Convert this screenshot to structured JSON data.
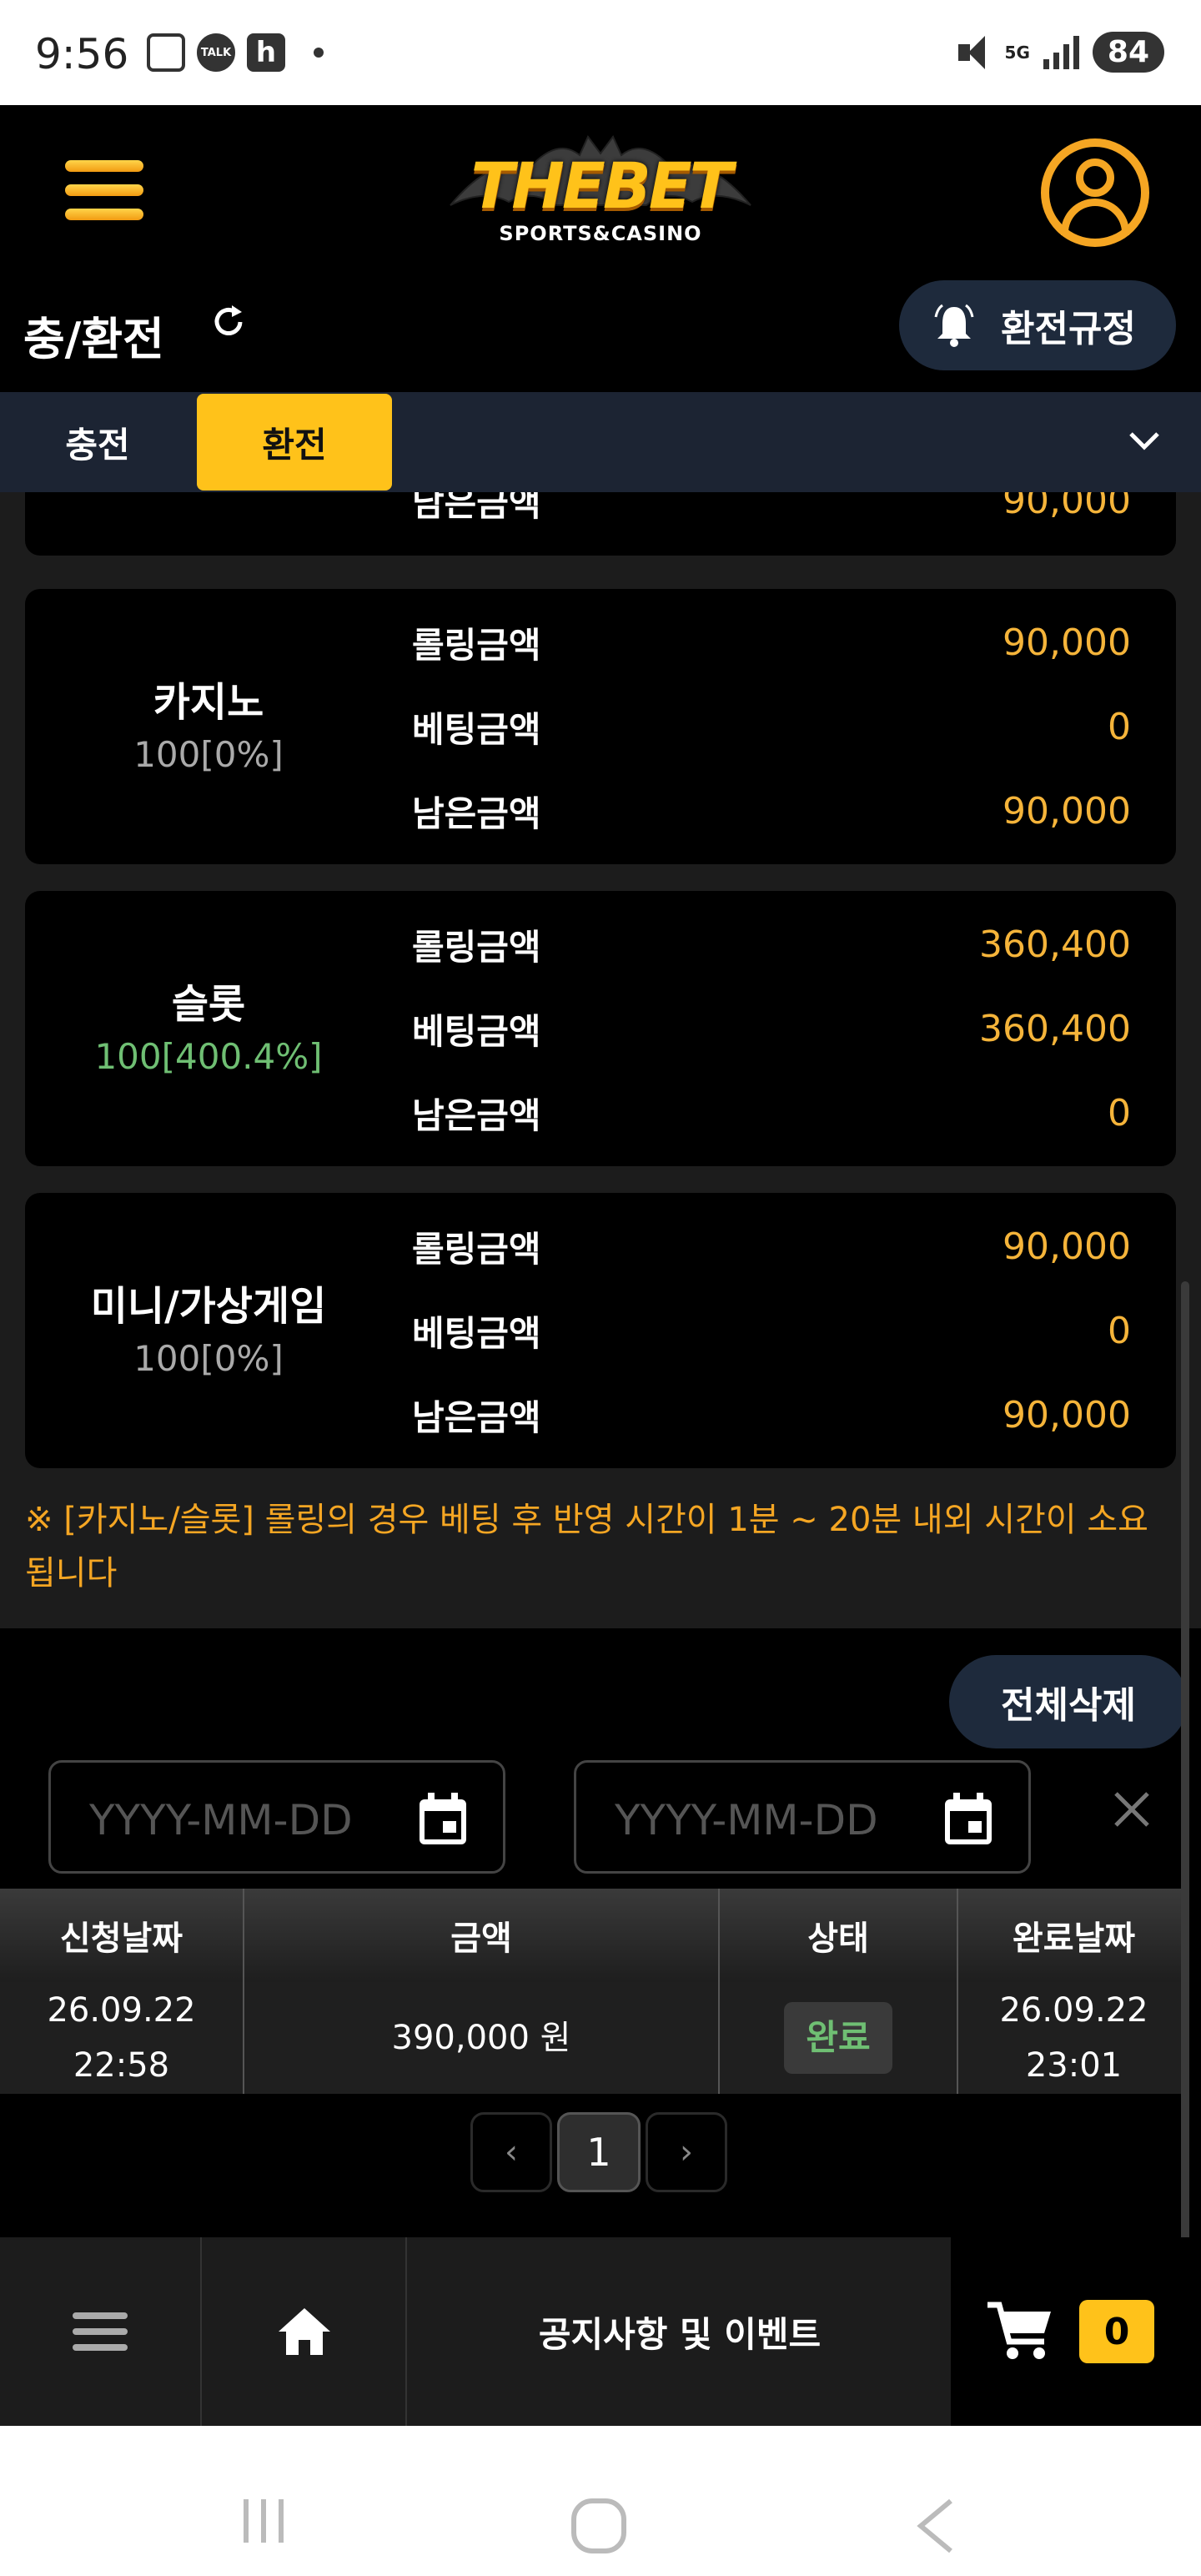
{
  "status_bar": {
    "time": "9:56",
    "talk_label": "TALK",
    "h_label": "h",
    "network": "5G",
    "battery": "84"
  },
  "header": {
    "logo_title": "THEBET",
    "logo_subtitle": "SPORTS&CASINO"
  },
  "title_bar": {
    "title": "충/환전",
    "rules_button": "환전규정"
  },
  "tabs": {
    "charge": "충전",
    "exchange": "환전"
  },
  "partial_row": {
    "label": "남은금액",
    "value": "90,000"
  },
  "cards": [
    {
      "name": "카지노",
      "percent": "100[0%]",
      "percent_color": "#aaaaaa",
      "rows": [
        {
          "label": "롤링금액",
          "value": "90,000"
        },
        {
          "label": "베팅금액",
          "value": "0"
        },
        {
          "label": "남은금액",
          "value": "90,000"
        }
      ]
    },
    {
      "name": "슬롯",
      "percent": "100[400.4%]",
      "percent_color": "#6fbf73",
      "rows": [
        {
          "label": "롤링금액",
          "value": "360,400"
        },
        {
          "label": "베팅금액",
          "value": "360,400"
        },
        {
          "label": "남은금액",
          "value": "0"
        }
      ]
    },
    {
      "name": "미니/가상게임",
      "percent": "100[0%]",
      "percent_color": "#aaaaaa",
      "rows": [
        {
          "label": "롤링금액",
          "value": "90,000"
        },
        {
          "label": "베팅금액",
          "value": "0"
        },
        {
          "label": "남은금액",
          "value": "90,000"
        }
      ]
    }
  ],
  "notice": "※ [카지노/슬롯] 롤링의 경우 베팅 후 반영 시간이 1분 ~ 20분 내외 시간이 소요됩니다",
  "history": {
    "delete_all": "전체삭제",
    "date_from_placeholder": "YYYY-MM-DD",
    "date_to_placeholder": "YYYY-MM-DD",
    "columns": [
      "신청날짜",
      "금액",
      "상태",
      "완료날짜"
    ],
    "rows": [
      {
        "request_date": "26.09.22",
        "request_time": "22:58",
        "amount": "390,000 원",
        "status": "완료",
        "complete_date": "26.09.22",
        "complete_time": "23:01"
      }
    ]
  },
  "pagination": {
    "prev": "‹",
    "current": "1",
    "next": "›"
  },
  "bottom_bar": {
    "notice_label": "공지사항 및 이벤트",
    "cart_count": "0"
  },
  "colors": {
    "accent": "#ffc21a",
    "value": "#f5b43a",
    "notice": "#f5a623",
    "success": "#6fbf73"
  }
}
